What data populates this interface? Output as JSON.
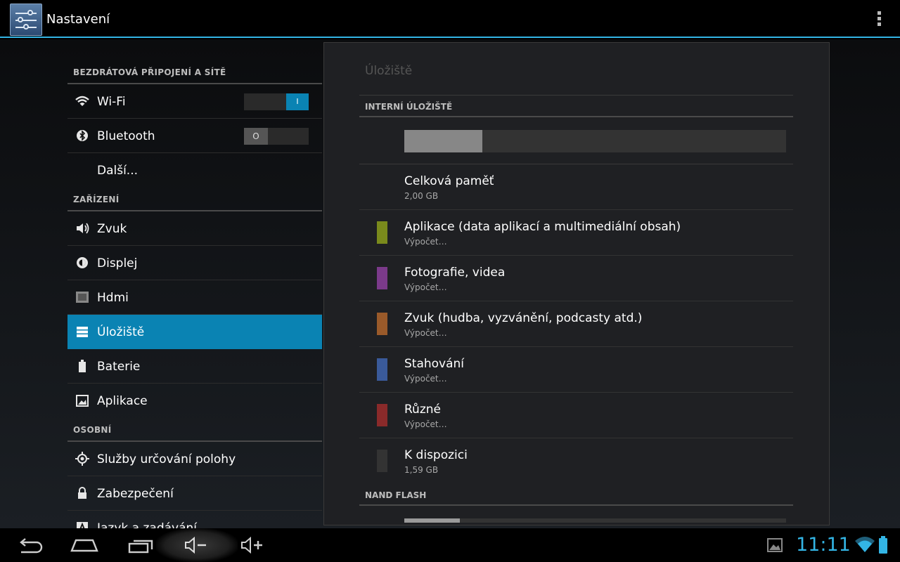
{
  "app": {
    "title": "Nastavení"
  },
  "colors": {
    "accent": "#33b5e5",
    "selected": "#0a83b3"
  },
  "sidebar": {
    "sections": [
      {
        "header": "BEZDRÁTOVÁ PŘIPOJENÍ A SÍTĚ",
        "items": [
          {
            "label": "Wi-Fi",
            "icon": "wifi-icon",
            "toggle": "I"
          },
          {
            "label": "Bluetooth",
            "icon": "bluetooth-icon",
            "toggle": "O"
          },
          {
            "label": "Další...",
            "icon": ""
          }
        ]
      },
      {
        "header": "ZAŘÍZENÍ",
        "items": [
          {
            "label": "Zvuk",
            "icon": "speaker-icon"
          },
          {
            "label": "Displej",
            "icon": "brightness-icon"
          },
          {
            "label": "Hdmi",
            "icon": "hdmi-icon"
          },
          {
            "label": "Úložiště",
            "icon": "storage-icon",
            "selected": true
          },
          {
            "label": "Baterie",
            "icon": "battery-icon"
          },
          {
            "label": "Aplikace",
            "icon": "apps-icon"
          }
        ]
      },
      {
        "header": "OSOBNÍ",
        "items": [
          {
            "label": "Služby určování polohy",
            "icon": "location-icon"
          },
          {
            "label": "Zabezpečení",
            "icon": "lock-icon"
          },
          {
            "label": "Jazyk a zadávání",
            "icon": "language-icon"
          }
        ]
      }
    ]
  },
  "storage": {
    "title": "Úložiště",
    "internal_header": "INTERNÍ ÚLOŽIŠTĚ",
    "internal_used_fraction": 0.205,
    "rows": [
      {
        "title": "Celková paměť",
        "value": "2,00 GB",
        "color": ""
      },
      {
        "title": "Aplikace (data aplikací a multimediální obsah)",
        "value": "Výpočet…",
        "color": "#7a8a1c"
      },
      {
        "title": "Fotografie, videa",
        "value": "Výpočet…",
        "color": "#7b3a8a"
      },
      {
        "title": "Zvuk (hudba, vyzvánění, podcasty atd.)",
        "value": "Výpočet…",
        "color": "#9a5a2a"
      },
      {
        "title": "Stahování",
        "value": "Výpočet…",
        "color": "#3a5a9a"
      },
      {
        "title": "Různé",
        "value": "Výpočet…",
        "color": "#8a2a2a"
      },
      {
        "title": "K dispozici",
        "value": "1,59 GB",
        "color": "#333333"
      }
    ],
    "nand_header": "NAND FLASH",
    "nand_used_fraction": 0.145
  },
  "statusbar": {
    "time": "11:11"
  }
}
